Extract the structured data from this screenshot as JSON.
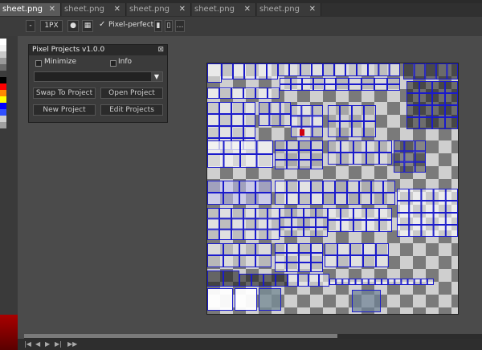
{
  "tabs": [
    {
      "label": "sheet.png",
      "active": true
    },
    {
      "label": "sheet.png",
      "active": false
    },
    {
      "label": "sheet.png",
      "active": false
    },
    {
      "label": "sheet.png",
      "active": false
    },
    {
      "label": "sheet.png",
      "active": false
    }
  ],
  "toolbar": {
    "brush_size": "1PX",
    "pixel_perfect_label": "Pixel-perfect",
    "pixel_perfect_checked": true
  },
  "panel": {
    "title": "Pixel Projects v1.0.0",
    "close_icon": "close-icon",
    "minimize_label": "Minimize",
    "info_label": "Info",
    "project_select_value": "",
    "buttons": {
      "swap": "Swap To Project",
      "open": "Open Project",
      "new": "New Project",
      "edit": "Edit Projects"
    }
  },
  "colors": {
    "sprite_outline": "#1a1acc",
    "checker_light": "#cfcfcf",
    "checker_dark": "#7a7a7a",
    "workspace": "#4b4b4b"
  },
  "palette_colors": [
    "#ffffff",
    "#f2f2f2",
    "#c8c8c8",
    "#9a9a9a",
    "#6b6b6b",
    "#3c3c3c",
    "#000000",
    "#ff0000",
    "#ff8800",
    "#ffff00",
    "#0000ff",
    "#3050ff",
    "#d0d0d0",
    "#a0a0a0"
  ]
}
